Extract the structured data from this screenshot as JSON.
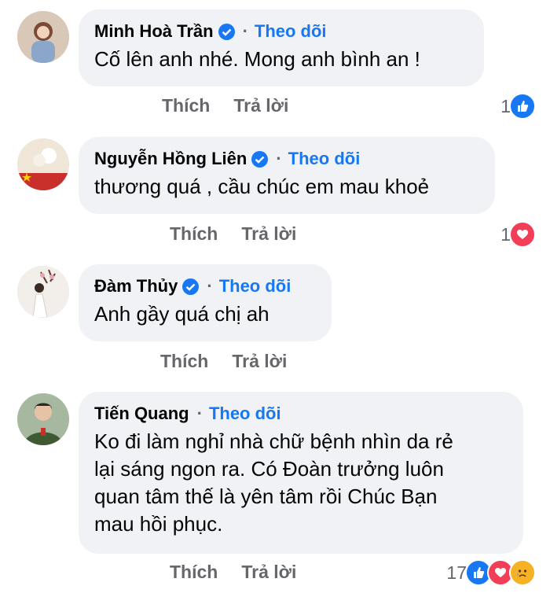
{
  "comments": [
    {
      "name": "Minh Hoà Trần",
      "verified": true,
      "follow": "Theo dõi",
      "text": "Cố lên anh nhé. Mong anh bình an !",
      "like": "Thích",
      "reply": "Trả lời",
      "reaction_count": "1",
      "reactions": [
        "like-icon"
      ]
    },
    {
      "name": "Nguyễn Hồng Liên",
      "verified": true,
      "follow": "Theo dõi",
      "text": "thương quá , cầu chúc em mau khoẻ",
      "like": "Thích",
      "reply": "Trả lời",
      "reaction_count": "1",
      "reactions": [
        "love-icon"
      ]
    },
    {
      "name": "Đàm Thủy",
      "verified": true,
      "follow": "Theo dõi",
      "text": "Anh gầy quá chị ah",
      "like": "Thích",
      "reply": "Trả lời"
    },
    {
      "name": "Tiến Quang",
      "verified": false,
      "follow": "Theo dõi",
      "text_lines": [
        "Ko đi làm nghỉ nhà chữ bệnh nhìn da rẻ",
        "lại sáng ngon ra. Có Đoàn trưởng luôn",
        "quan tâm thế là yên tâm rồi Chúc Bạn",
        "mau hồi phục."
      ],
      "like": "Thích",
      "reply": "Trả lời",
      "reaction_count": "17",
      "reactions": [
        "like-icon",
        "love-icon",
        "sad-icon"
      ]
    }
  ],
  "follow_separator": "·",
  "colors": {
    "accent": "#1877f2",
    "bubble": "#f0f2f5",
    "love": "#f33e58",
    "sad": "#f7b125"
  }
}
